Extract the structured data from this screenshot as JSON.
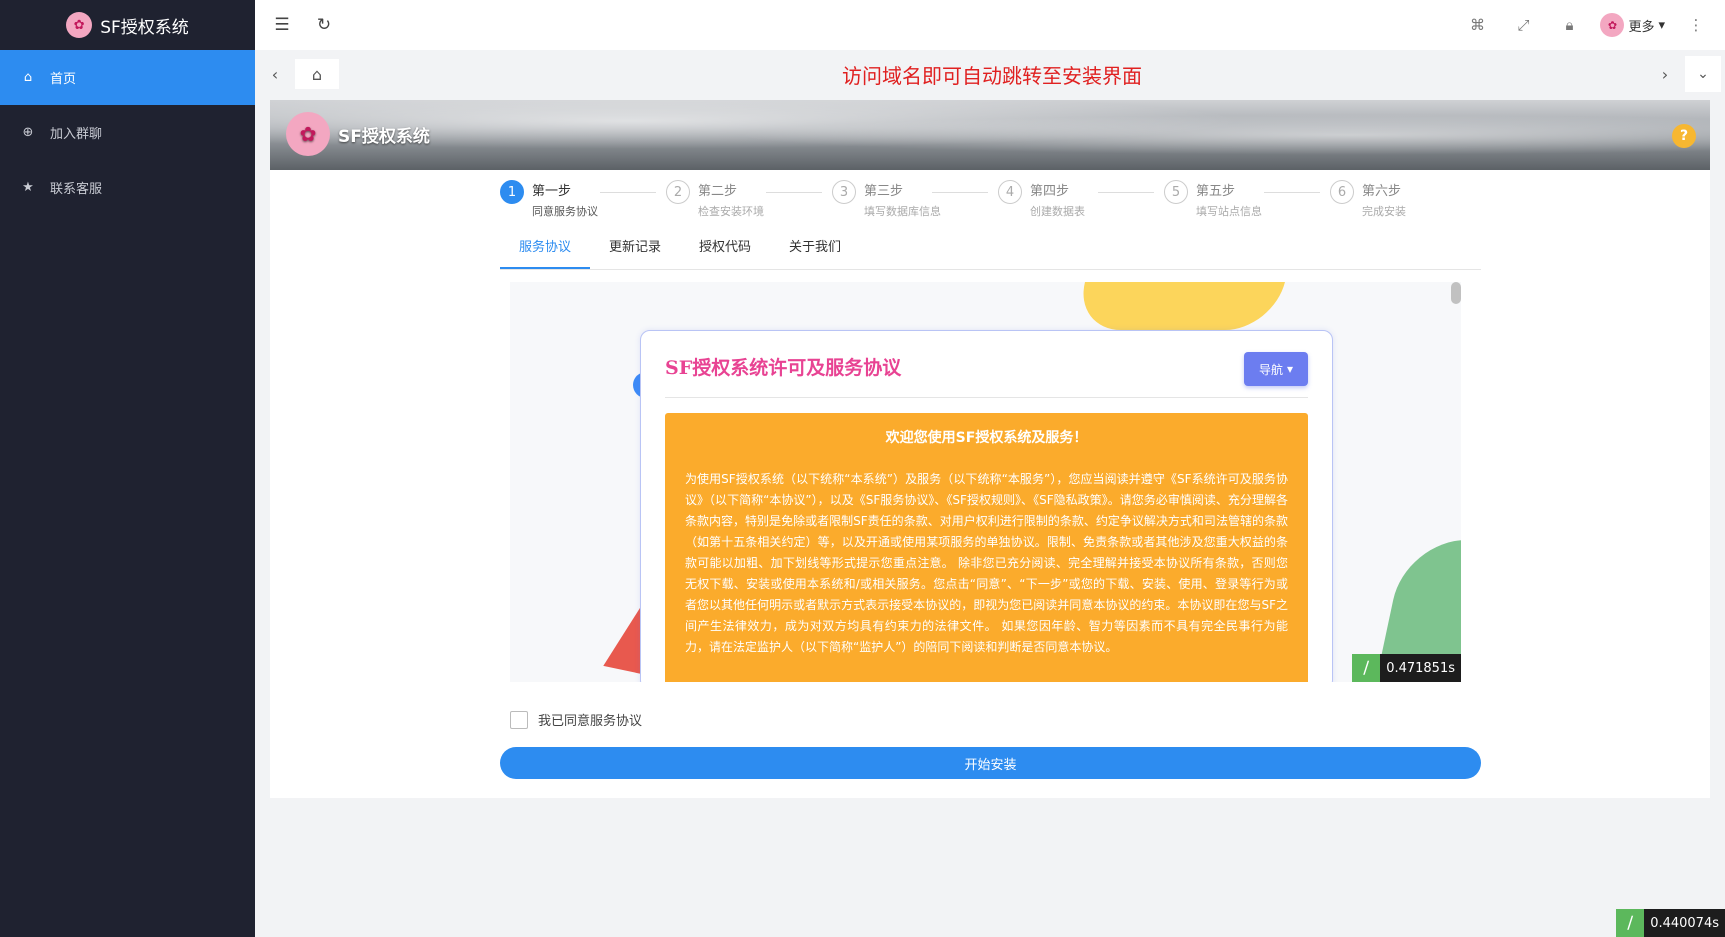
{
  "app": {
    "title": "SF授权系统",
    "logo_icon": "lotus-icon"
  },
  "sidebar": {
    "items": [
      {
        "label": "首页",
        "icon": "home-icon",
        "active": true
      },
      {
        "label": "加入群聊",
        "icon": "download-circle-icon",
        "active": false
      },
      {
        "label": "联系客服",
        "icon": "star-icon",
        "active": false
      }
    ]
  },
  "header": {
    "user_label": "更多"
  },
  "tabstrip": {
    "notice": "访问域名即可自动跳转至安装界面"
  },
  "banner": {
    "brand": "SF授权系统",
    "help": "?"
  },
  "steps": [
    {
      "num": "1",
      "title": "第一步",
      "desc": "同意服务协议"
    },
    {
      "num": "2",
      "title": "第二步",
      "desc": "检查安装环境"
    },
    {
      "num": "3",
      "title": "第三步",
      "desc": "填写数据库信息"
    },
    {
      "num": "4",
      "title": "第四步",
      "desc": "创建数据表"
    },
    {
      "num": "5",
      "title": "第五步",
      "desc": "填写站点信息"
    },
    {
      "num": "6",
      "title": "第六步",
      "desc": "完成安装"
    }
  ],
  "tabs": [
    {
      "label": "服务协议",
      "active": true
    },
    {
      "label": "更新记录",
      "active": false
    },
    {
      "label": "授权代码",
      "active": false
    },
    {
      "label": "关于我们",
      "active": false
    }
  ],
  "agreement": {
    "title": "SF授权系统许可及服务协议",
    "nav_label": "导航",
    "welcome": "欢迎您使用SF授权系统及服务！",
    "body": "为使用SF授权系统（以下统称“本系统”）及服务（以下统称“本服务”），您应当阅读并遵守《SF系统许可及服务协议》（以下简称“本协议”），以及《SF服务协议》、《SF授权规则》、《SF隐私政策》。请您务必审慎阅读、充分理解各条款内容，特别是免除或者限制SF责任的条款、对用户权利进行限制的条款、约定争议解决方式和司法管辖的条款（如第十五条相关约定）等，以及开通或使用某项服务的单独协议。限制、免责条款或者其他涉及您重大权益的条款可能以加粗、加下划线等形式提示您重点注意。 除非您已充分阅读、完全理解并接受本协议所有条款，否则您无权下载、安装或使用本系统和/或相关服务。您点击“同意”、“下一步”或您的下载、安装、使用、登录等行为或者您以其他任何明示或者默示方式表示接受本协议的，即视为您已阅读并同意本协议的约束。本协议即在您与SF之间产生法律效力，成为对双方均具有约束力的法律文件。 如果您因年龄、智力等因素而不具有完全民事行为能力，请在法定监护人（以下简称“监护人”）的陪同下阅读和判断是否同意本协议。"
  },
  "frame_timer": "0.471851s",
  "agree_label": "我已同意服务协议",
  "install_button": "开始安装",
  "global_timer": "0.440074s",
  "colors": {
    "sidebar_bg": "#1f2230",
    "primary": "#2d8cf0",
    "notice": "#e02020",
    "agreement_bg": "#fbab2c",
    "title_pink": "#e84393"
  }
}
